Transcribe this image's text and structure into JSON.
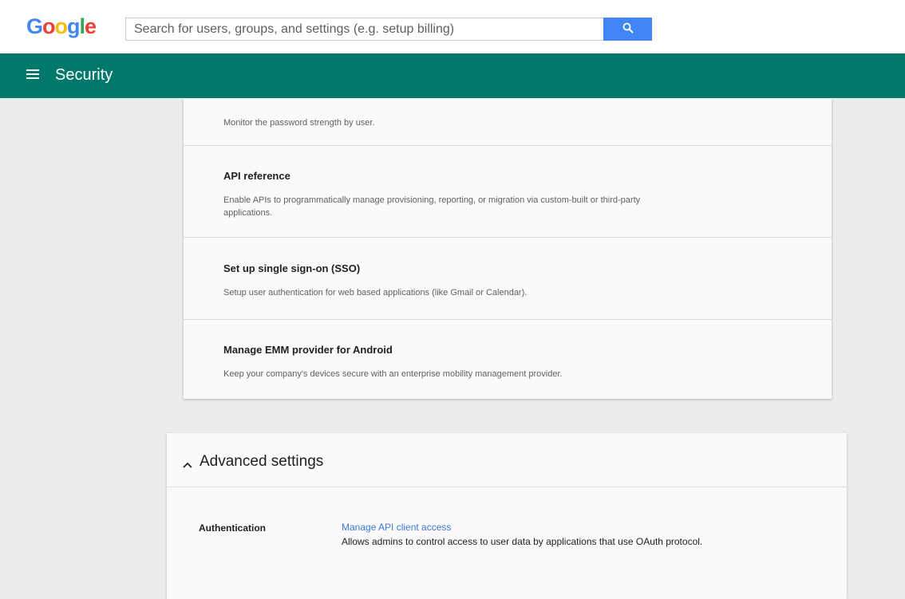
{
  "brand": {
    "logo_letters": [
      {
        "char": "G",
        "color": "#4285f4"
      },
      {
        "char": "o",
        "color": "#ea4335"
      },
      {
        "char": "o",
        "color": "#fbbc05"
      },
      {
        "char": "g",
        "color": "#4285f4"
      },
      {
        "char": "l",
        "color": "#34a853"
      },
      {
        "char": "e",
        "color": "#ea4335"
      }
    ]
  },
  "search": {
    "placeholder": "Search for users, groups, and settings (e.g. setup billing)",
    "value": "",
    "icon": "search-icon"
  },
  "header": {
    "menu_icon": "hamburger-menu-icon",
    "title": "Security",
    "background": "#00796b"
  },
  "cards": [
    {
      "title": "",
      "description": "Monitor the password strength by user."
    },
    {
      "title": "API reference",
      "description": "Enable APIs to programmatically manage provisioning, reporting, or migration via custom-built or third-party applications."
    },
    {
      "title": "Set up single sign-on (SSO)",
      "description": "Setup user authentication for web based applications (like Gmail or Calendar)."
    },
    {
      "title": "Manage EMM provider for Android",
      "description": "Keep your company's devices secure with an enterprise mobility management provider."
    }
  ],
  "advanced": {
    "title": "Advanced settings",
    "chevron_icon": "chevron-up-icon",
    "row": {
      "label": "Authentication",
      "link": "Manage API client access",
      "description": "Allows admins to control access to user data by applications that use OAuth protocol."
    }
  },
  "colors": {
    "accent": "#00796b",
    "link": "#3c78d8",
    "search_button": "#4285f4"
  }
}
